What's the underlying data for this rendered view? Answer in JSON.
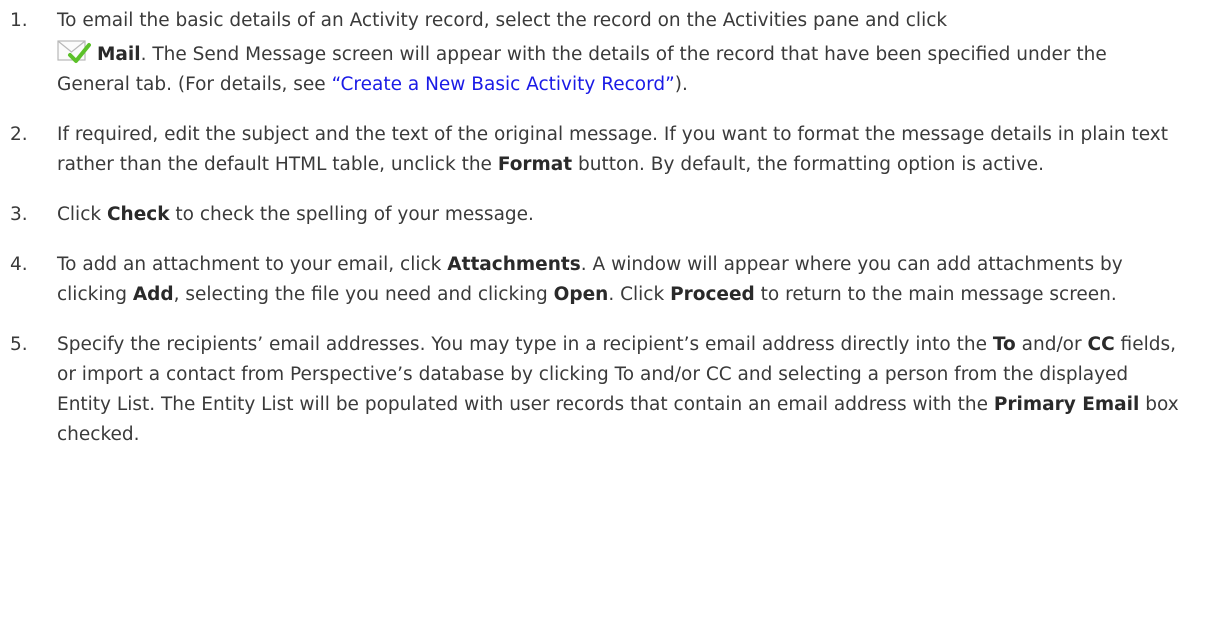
{
  "steps": [
    {
      "num": "1.",
      "t1": "To email the basic details of an Activity record, select the record on the Activities pane and click",
      "b1": "Mail",
      "t2": ". The Send Message screen will appear with the details of the record that have been specified under the General tab. (For details, see ",
      "link": "“Create a New Basic Activity Record”",
      "t3": ")."
    },
    {
      "num": "2.",
      "t1": "If required, edit the subject and the text of the original message. If you want to format the message details in plain text rather than the default HTML table, unclick the ",
      "b1": "Format",
      "t2": " button. By default, the formatting option is active."
    },
    {
      "num": "3.",
      "t1": "Click ",
      "b1": "Check",
      "t2": " to check the spelling of your message."
    },
    {
      "num": "4.",
      "t1": "To add an attachment to your email, click ",
      "b1": "Attachments",
      "t2": ". A window will appear where you can add attachments by clicking ",
      "b2": "Add",
      "t3": ", selecting the file you need and clicking ",
      "b3": "Open",
      "t4": ". Click ",
      "b4": "Proceed",
      "t5": " to return to the main message screen."
    },
    {
      "num": "5.",
      "t1": "Specify the recipients’ email addresses. You may type in a recipient’s email address directly into the ",
      "b1": "To",
      "t2": " and/or ",
      "b2": "CC",
      "t3": " fields, or import a contact from Perspective’s database by clicking To and/or CC and selecting a person from the displayed Entity List. The Entity List will be populated with user records that contain an email address with the ",
      "b3": "Primary Email",
      "t4": " box checked."
    }
  ],
  "icons": {
    "mail": "mail-checkmark-icon"
  },
  "colors": {
    "text": "#3a3a3a",
    "link": "#1a1ae6",
    "check": "#5cc12a"
  }
}
